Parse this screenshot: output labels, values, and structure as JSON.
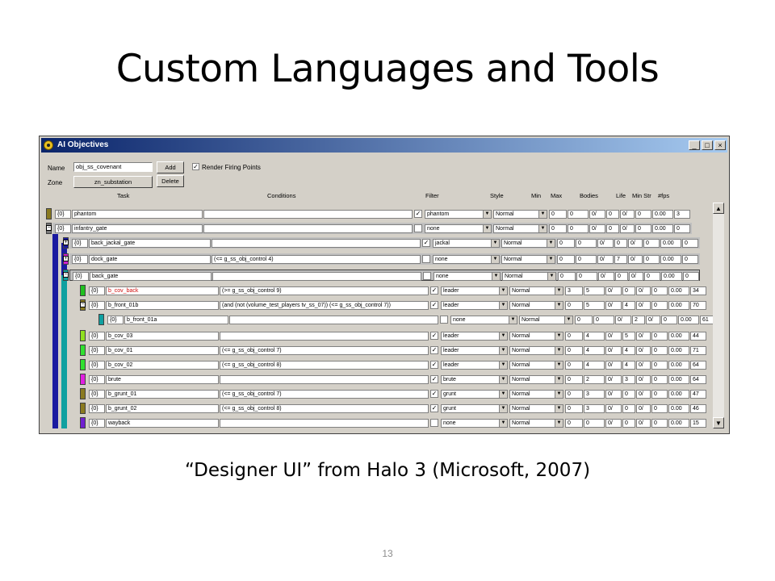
{
  "slide": {
    "title": "Custom Languages and Tools",
    "caption": "“Designer UI” from Halo 3 (Microsoft, 2007)",
    "page_number": "13"
  },
  "window": {
    "title": "AI Objectives",
    "minimize_icon": "minimize-icon",
    "maximize_icon": "maximize-icon",
    "close_icon": "close-icon"
  },
  "form": {
    "name_label": "Name",
    "name_value": "obj_ss_covenant",
    "zone_label": "Zone",
    "zone_value": "zn_substation",
    "add_label": "Add",
    "delete_label": "Delete",
    "render_label": "Render Firing Points",
    "render_checked": true
  },
  "columns": [
    "Task",
    "Conditions",
    "Filter",
    "Style",
    "Min",
    "Max",
    "Bodies",
    "Life",
    "Min Str",
    "#fps"
  ],
  "rows": [
    {
      "indent": 0,
      "color": "#8a7a20",
      "expander": "",
      "task": "phantom",
      "prefix": "{0}",
      "cond": "",
      "checked": true,
      "filter": "phantom",
      "style": "Normal",
      "min": "0",
      "max": "0",
      "bodies": "0/",
      "bodies2": "0",
      "life": "0/",
      "life2": "0",
      "minstr": "0.00",
      "fps": "3",
      "group": false,
      "red": false
    },
    {
      "indent": 0,
      "color": "#7a7a7a",
      "expander": "−",
      "task": "infantry_gate",
      "prefix": "{0}",
      "cond": "",
      "checked": false,
      "filter": "none",
      "style": "Normal",
      "min": "0",
      "max": "0",
      "bodies": "0/",
      "bodies2": "0",
      "life": "0/",
      "life2": "0",
      "minstr": "0.00",
      "fps": "0",
      "group": true,
      "red": false
    },
    {
      "indent": 1,
      "color": "#1a1aa0",
      "expander": "+",
      "task": "back_jackal_gate",
      "prefix": "{0}",
      "cond": "",
      "checked": true,
      "filter": "jackal",
      "style": "Normal",
      "min": "0",
      "max": "0",
      "bodies": "0/",
      "bodies2": "0",
      "life": "0/",
      "life2": "0",
      "minstr": "0.00",
      "fps": "0",
      "group": true,
      "red": false
    },
    {
      "indent": 1,
      "color": "#d020d0",
      "expander": "+",
      "task": "dock_gate",
      "prefix": "{0}",
      "cond": "(<= g_ss_obj_control 4)",
      "checked": false,
      "filter": "none",
      "style": "Normal",
      "min": "0",
      "max": "0",
      "bodies": "0/",
      "bodies2": "7",
      "life": "0/",
      "life2": "0",
      "minstr": "0.00",
      "fps": "0",
      "group": true,
      "red": false
    },
    {
      "indent": 1,
      "color": "#10a0a0",
      "expander": "−",
      "task": "back_gate",
      "prefix": "{0}",
      "cond": "",
      "checked": false,
      "filter": "none",
      "style": "Normal",
      "min": "0",
      "max": "0",
      "bodies": "0/",
      "bodies2": "0",
      "life": "0/",
      "life2": "0",
      "minstr": "0.00",
      "fps": "0",
      "group": true,
      "red": false,
      "outlined": true
    },
    {
      "indent": 2,
      "color": "#20c020",
      "expander": "",
      "task": "b_cov_back",
      "prefix": "{0}",
      "cond": "(>= g_ss_obj_control 9)",
      "checked": true,
      "filter": "leader",
      "style": "Normal",
      "min": "3",
      "max": "5",
      "bodies": "0/",
      "bodies2": "0",
      "life": "0/",
      "life2": "0",
      "minstr": "0.00",
      "fps": "34",
      "group": false,
      "red": true
    },
    {
      "indent": 2,
      "color": "#8a7a20",
      "expander": "−",
      "task": "b_front_01b",
      "prefix": "{0}",
      "cond": "(and (not (volume_test_players tv_ss_07)) (<= g_ss_obj_control 7))",
      "checked": true,
      "filter": "leader",
      "style": "Normal",
      "min": "0",
      "max": "5",
      "bodies": "0/",
      "bodies2": "4",
      "life": "0/",
      "life2": "0",
      "minstr": "0.00",
      "fps": "70",
      "group": false,
      "red": false
    },
    {
      "indent": 3,
      "color": "#10a0a0",
      "expander": "",
      "task": "b_front_01a",
      "prefix": "{0}",
      "cond": "",
      "checked": false,
      "filter": "none",
      "style": "Normal",
      "min": "0",
      "max": "0",
      "bodies": "0/",
      "bodies2": "2",
      "life": "0/",
      "life2": "0",
      "minstr": "0.00",
      "fps": "61",
      "group": false,
      "red": false
    },
    {
      "indent": 2,
      "color": "#90e020",
      "expander": "",
      "task": "b_cov_03",
      "prefix": "{0}",
      "cond": "",
      "checked": true,
      "filter": "leader",
      "style": "Normal",
      "min": "0",
      "max": "4",
      "bodies": "0/",
      "bodies2": "5",
      "life": "0/",
      "life2": "0",
      "minstr": "0.00",
      "fps": "44",
      "group": false,
      "red": false
    },
    {
      "indent": 2,
      "color": "#30e030",
      "expander": "",
      "task": "b_cov_01",
      "prefix": "{0}",
      "cond": "(<= g_ss_obj_control 7)",
      "checked": true,
      "filter": "leader",
      "style": "Normal",
      "min": "0",
      "max": "4",
      "bodies": "0/",
      "bodies2": "4",
      "life": "0/",
      "life2": "0",
      "minstr": "0.00",
      "fps": "71",
      "group": false,
      "red": false
    },
    {
      "indent": 2,
      "color": "#30e030",
      "expander": "",
      "task": "b_cov_02",
      "prefix": "{0}",
      "cond": "(<= g_ss_obj_control 8)",
      "checked": true,
      "filter": "leader",
      "style": "Normal",
      "min": "0",
      "max": "4",
      "bodies": "0/",
      "bodies2": "4",
      "life": "0/",
      "life2": "0",
      "minstr": "0.00",
      "fps": "64",
      "group": false,
      "red": false
    },
    {
      "indent": 2,
      "color": "#e020e0",
      "expander": "",
      "task": "brute",
      "prefix": "{0}",
      "cond": "",
      "checked": true,
      "filter": "brute",
      "style": "Normal",
      "min": "0",
      "max": "2",
      "bodies": "0/",
      "bodies2": "3",
      "life": "0/",
      "life2": "0",
      "minstr": "0.00",
      "fps": "64",
      "group": false,
      "red": false
    },
    {
      "indent": 2,
      "color": "#8a7a20",
      "expander": "",
      "task": "b_grunt_01",
      "prefix": "{0}",
      "cond": "(<= g_ss_obj_control 7)",
      "checked": true,
      "filter": "grunt",
      "style": "Normal",
      "min": "0",
      "max": "3",
      "bodies": "0/",
      "bodies2": "0",
      "life": "0/",
      "life2": "0",
      "minstr": "0.00",
      "fps": "47",
      "group": false,
      "red": false
    },
    {
      "indent": 2,
      "color": "#8a7a20",
      "expander": "",
      "task": "b_grunt_02",
      "prefix": "{0}",
      "cond": "(<= g_ss_obj_control 8)",
      "checked": true,
      "filter": "grunt",
      "style": "Normal",
      "min": "0",
      "max": "3",
      "bodies": "0/",
      "bodies2": "0",
      "life": "0/",
      "life2": "0",
      "minstr": "0.00",
      "fps": "46",
      "group": false,
      "red": false
    },
    {
      "indent": 2,
      "color": "#7020d0",
      "expander": "",
      "task": "wayback",
      "prefix": "{0}",
      "cond": "",
      "checked": false,
      "filter": "none",
      "style": "Normal",
      "min": "0",
      "max": "0",
      "bodies": "0/",
      "bodies2": "0",
      "life": "0/",
      "life2": "0",
      "minstr": "0.00",
      "fps": "15",
      "group": false,
      "red": false
    }
  ]
}
